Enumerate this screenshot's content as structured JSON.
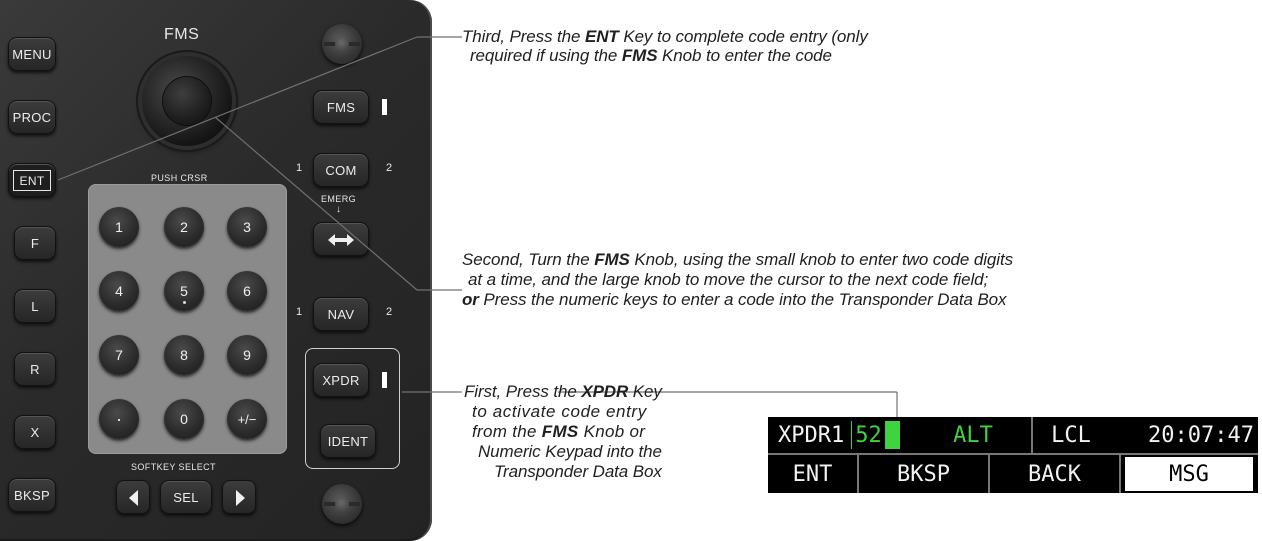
{
  "bezel": {
    "title": "FMS",
    "left_keys": [
      "MENU",
      "PROC",
      "ENT",
      "F",
      "L",
      "R",
      "X",
      "BKSP"
    ],
    "right_keys": {
      "fms": "FMS",
      "com": "COM",
      "emerg": "EMERG",
      "nav": "NAV",
      "xpdr": "XPDR",
      "ident": "IDENT"
    },
    "com_left": "1",
    "com_right": "2",
    "nav_left": "1",
    "nav_right": "2",
    "push_crsr": "PUSH CRSR",
    "softkey_select": "SOFTKEY SELECT",
    "sel": "SEL",
    "keypad": [
      "1",
      "2",
      "3",
      "4",
      "5",
      "6",
      "7",
      "8",
      "9",
      "·",
      "0",
      "+/−"
    ]
  },
  "callouts": {
    "third": {
      "l1a": "Third, Press the ",
      "l1b": "ENT",
      "l1c": " Key to complete code entry (only",
      "l2a": "required if using the ",
      "l2b": "FMS",
      "l2c": " Knob to enter the code"
    },
    "second": {
      "l1a": "Second, Turn the ",
      "l1b": "FMS",
      "l1c": " Knob, using the small knob to enter two code digits",
      "l2": "at a time, and the large knob to move the cursor to the next code field;",
      "l3a": "or",
      "l3b": " Press the numeric keys to enter a code into the Transponder Data Box"
    },
    "first": {
      "l1a": "First, Press the ",
      "l1b": "XPDR",
      "l1c": " Key",
      "l2": "to activate code entry",
      "l3a": "from the ",
      "l3b": "FMS",
      "l3c": " Knob or",
      "l4": "Numeric Keypad into the",
      "l5": "Transponder Data Box"
    }
  },
  "display": {
    "xpdr_label": "XPDR1",
    "code_entry": "52",
    "mode": "ALT",
    "lcl": "LCL",
    "time": "20:07:47",
    "softkeys": [
      "ENT",
      "BKSP",
      "BACK",
      "MSG"
    ]
  },
  "colors": {
    "bezel": "#2a2a2a",
    "keypad_panel": "#8a8a8a",
    "code_green": "#3fd43f",
    "callout_text": "#1f1f1f",
    "leader_line": "#707070"
  }
}
